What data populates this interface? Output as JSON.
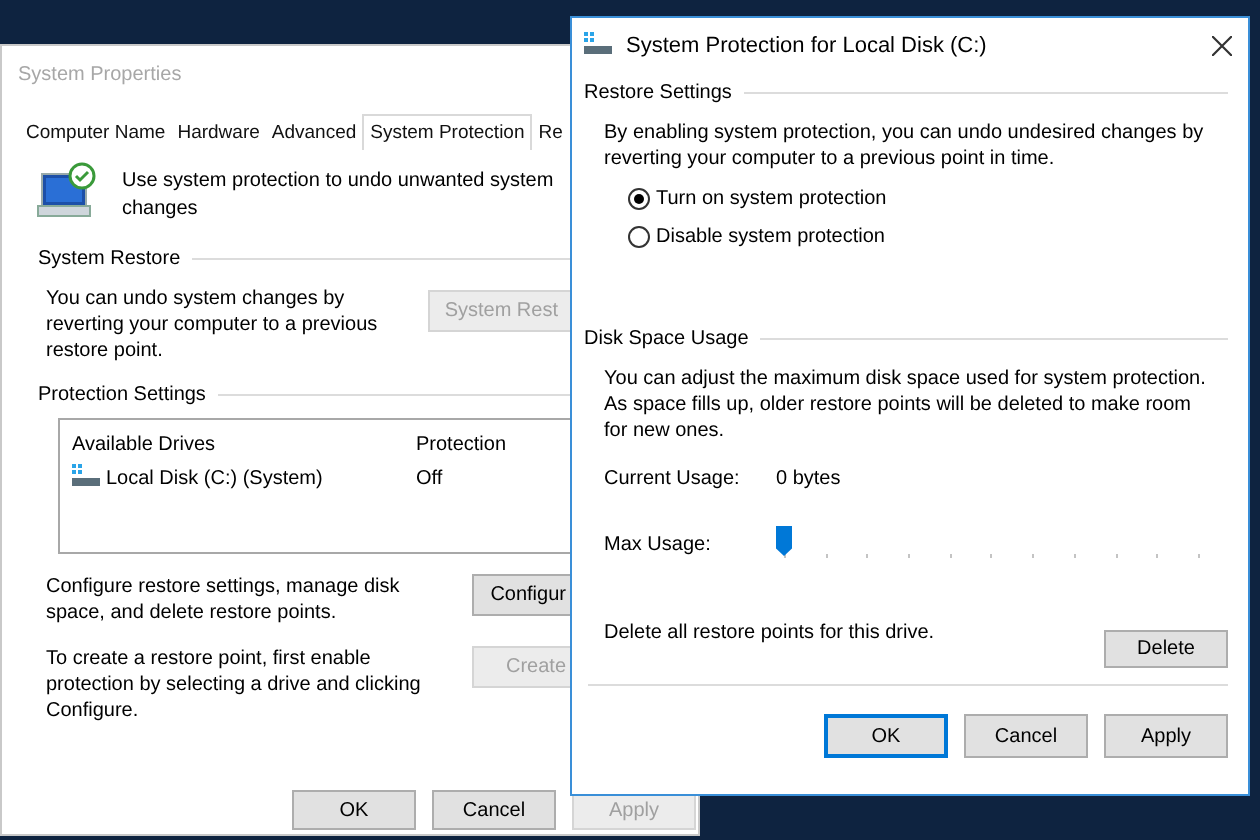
{
  "system_properties": {
    "title": "System Properties",
    "tabs": [
      {
        "label": "Computer Name",
        "selected": false
      },
      {
        "label": "Hardware",
        "selected": false
      },
      {
        "label": "Advanced",
        "selected": false
      },
      {
        "label": "System Protection",
        "selected": true
      },
      {
        "label": "Re",
        "selected": false
      }
    ],
    "intro": "Use system protection to undo unwanted system changes",
    "system_restore": {
      "heading": "System Restore",
      "text": "You can undo system changes by reverting your computer to a previous restore point.",
      "button": {
        "label": "System Rest",
        "disabled": true
      }
    },
    "protection_settings": {
      "heading": "Protection Settings",
      "columns": [
        "Available Drives",
        "Protection"
      ],
      "rows": [
        {
          "drive": "Local Disk (C:) (System)",
          "protection": "Off"
        }
      ],
      "configure": {
        "text": "Configure restore settings, manage disk space, and delete restore points.",
        "button": {
          "label": "Configur",
          "disabled": false
        }
      },
      "create": {
        "text": "To create a restore point, first enable protection by selecting a drive and clicking Configure.",
        "button": {
          "label": "Create",
          "disabled": true
        }
      }
    },
    "buttons": [
      {
        "label": "OK",
        "disabled": false
      },
      {
        "label": "Cancel",
        "disabled": false
      },
      {
        "label": "Apply",
        "disabled": true
      }
    ]
  },
  "dialog": {
    "title": "System Protection for Local Disk (C:)",
    "restore_settings": {
      "heading": "Restore Settings",
      "text": "By enabling system protection, you can undo undesired changes by reverting your computer to a previous point in time.",
      "options": [
        {
          "label": "Turn on system protection",
          "selected": true
        },
        {
          "label": "Disable system protection",
          "selected": false
        }
      ]
    },
    "disk_space": {
      "heading": "Disk Space Usage",
      "text": "You can adjust the maximum disk space used for system protection. As space fills up, older restore points will be deleted to make room for new ones.",
      "current_label": "Current Usage:",
      "current_value": "0 bytes",
      "max_label": "Max Usage:",
      "level": 0
    },
    "delete_text": "Delete all restore points for this drive.",
    "delete_button": "Delete",
    "buttons": [
      {
        "label": "OK",
        "focused": true
      },
      {
        "label": "Cancel",
        "focused": false
      },
      {
        "label": "Apply",
        "focused": false
      }
    ]
  }
}
